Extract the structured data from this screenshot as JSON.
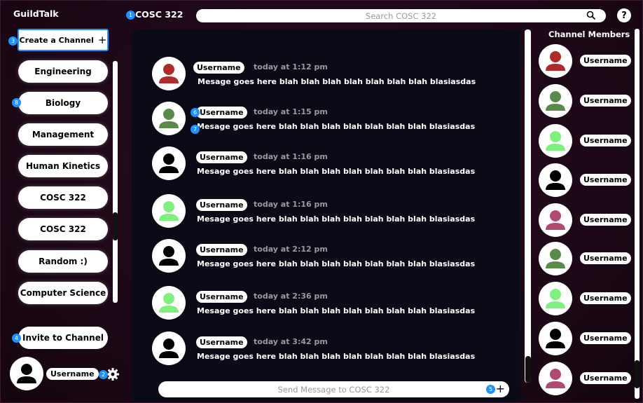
{
  "app": {
    "brand": "GuildTalk"
  },
  "header": {
    "channel_title": "COSC 322",
    "search_placeholder": "Search COSC 322",
    "help_label": "?"
  },
  "badges": {
    "b1": "1",
    "b2": "2",
    "b3": "3",
    "b4": "4",
    "b5": "5",
    "b6": "6",
    "b7": "7",
    "b8": "8"
  },
  "sidebar": {
    "create_label": "Create a Channel",
    "create_plus": "+",
    "channels": [
      "Engineering",
      "Biology",
      "Management",
      "Human Kinetics",
      "COSC 322",
      "COSC 322",
      "Random :)",
      "Computer Science"
    ],
    "invite_label": "Invite to Channel",
    "user_name": "Username"
  },
  "messages": [
    {
      "user": "Username",
      "time": "today at 1:12 pm",
      "text": "Mesage goes here blah blah blah blah blah blah blah blasiasdas",
      "avatar_color": "#b02a2a"
    },
    {
      "user": "Username",
      "time": "today at 1:15 pm",
      "text": "Mesage goes here blah blah blah blah blah blah blah blasiasdas",
      "avatar_color": "#5a8a4a"
    },
    {
      "user": "Username",
      "time": "today at 1:16 pm",
      "text": "Mesage goes here blah blah blah blah blah blah blah blasiasdas",
      "avatar_color": "#000000"
    },
    {
      "user": "Username",
      "time": "today at 1:16 pm",
      "text": "Mesage goes here blah blah blah blah blah blah blah blasiasdas",
      "avatar_color": "#7ef07e"
    },
    {
      "user": "Username",
      "time": "today at 2:12 pm",
      "text": "Mesage goes here blah blah blah blah blah blah blah blasiasdas",
      "avatar_color": "#000000"
    },
    {
      "user": "Username",
      "time": "today at 2:36 pm",
      "text": "Mesage goes here blah blah blah blah blah blah blah blasiasdas",
      "avatar_color": "#7ef07e"
    },
    {
      "user": "Username",
      "time": "today at 3:42 pm",
      "text": "Mesage goes here blah blah blah blah blah blah blah blasiasdas",
      "avatar_color": "#000000"
    }
  ],
  "composer": {
    "placeholder": "Send Message to COSC 322",
    "plus": "+"
  },
  "members": {
    "title": "Channel Members",
    "list": [
      {
        "name": "Username",
        "avatar_color": "#b02a2a"
      },
      {
        "name": "Username",
        "avatar_color": "#5a8a4a"
      },
      {
        "name": "Username",
        "avatar_color": "#7ef07e"
      },
      {
        "name": "Username",
        "avatar_color": "#000000"
      },
      {
        "name": "Username",
        "avatar_color": "#b04a70"
      },
      {
        "name": "Username",
        "avatar_color": "#5a8a4a"
      },
      {
        "name": "Username",
        "avatar_color": "#7ef07e"
      },
      {
        "name": "Username",
        "avatar_color": "#000000"
      },
      {
        "name": "Username",
        "avatar_color": "#b04a70"
      }
    ]
  }
}
